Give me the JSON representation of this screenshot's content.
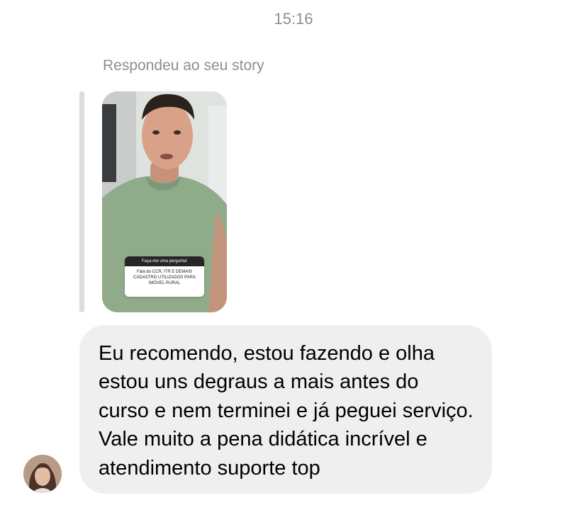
{
  "timestamp": "15:16",
  "reply": {
    "label": "Respondeu ao seu story"
  },
  "story": {
    "question_header": "Faça-me uma pergunta!",
    "question_text": "Fala do CCR, ITR E DEMAIS CADASTRO UTILIZADOS PARA IMÓVEL RURAL"
  },
  "message": {
    "text": "Eu recomendo, estou fazendo e olha estou uns degraus a mais antes do curso e nem terminei e já peguei serviço. Vale muito a pena didática incrível e atendimento suporte top"
  }
}
